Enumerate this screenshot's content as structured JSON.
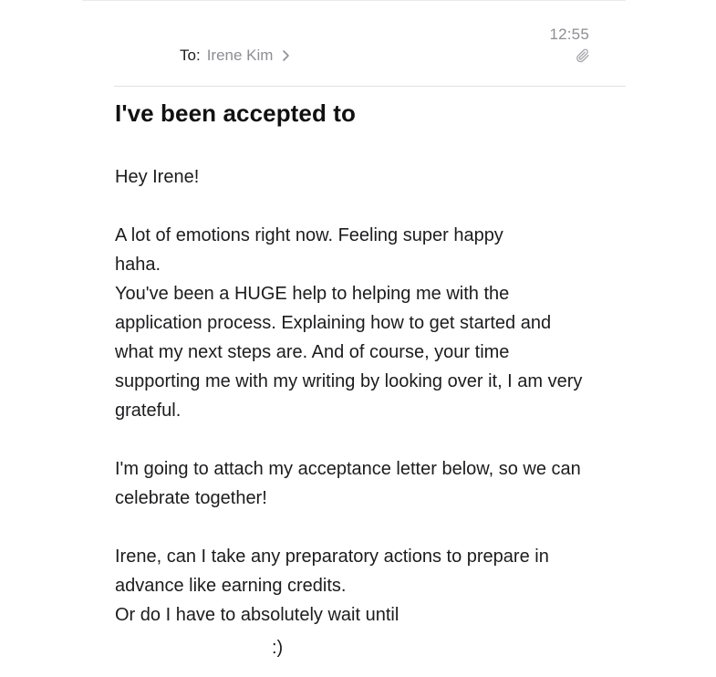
{
  "header": {
    "time": "12:55",
    "to_label": "To:",
    "recipient": "Irene Kim",
    "attachment_icon": "paperclip-icon",
    "chevron_icon": "chevron-right-icon"
  },
  "email": {
    "subject": "I've been accepted to",
    "greeting": "Hey Irene!",
    "para1_line1": "A lot of emotions right now. Feeling super happy",
    "para1_line2": "haha.",
    "para2": "You've been a HUGE help to helping me with the application process. Explaining how to get started and what my next steps are. And of course, your time supporting me with my writing by looking over it, I am very grateful.",
    "para3": "I'm going to attach my acceptance letter below, so we can celebrate together!",
    "para4_line1": "Irene, can I take any preparatory actions to prepare in advance like earning credits.",
    "para4_line2": "Or do I have to absolutely wait until",
    "signoff": ":)"
  },
  "colors": {
    "text": "#1c1c1e",
    "secondary": "#8e8e93",
    "divider": "#e2e2e5"
  }
}
